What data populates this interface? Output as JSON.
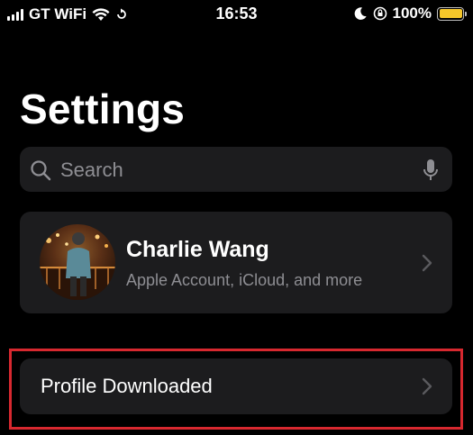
{
  "status_bar": {
    "carrier": "GT WiFi",
    "time": "16:53",
    "battery": "100%",
    "battery_level": 1.0,
    "icons": [
      "signal-icon",
      "wifi-icon",
      "location-arrow-icon",
      "moon-icon",
      "orientation-lock-icon",
      "battery-icon"
    ]
  },
  "header": {
    "title": "Settings"
  },
  "search": {
    "placeholder": "Search",
    "icons": [
      "search-icon",
      "microphone-icon"
    ]
  },
  "account": {
    "name": "Charlie Wang",
    "subtitle": "Apple Account, iCloud, and more"
  },
  "profile_row": {
    "label": "Profile Downloaded"
  },
  "colors": {
    "background": "#000000",
    "card": "#1c1c1e",
    "secondary_text": "#8e8e93",
    "battery": "#f4c62a",
    "highlight": "#d7282f"
  }
}
